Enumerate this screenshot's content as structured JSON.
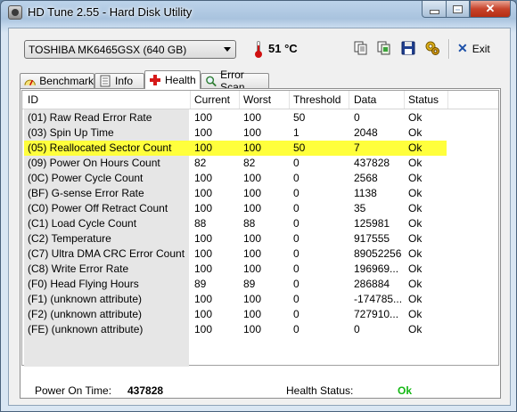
{
  "window": {
    "title": "HD Tune 2.55 - Hard Disk Utility"
  },
  "toolbar": {
    "drive": "TOSHIBA MK6465GSX (640 GB)",
    "temperature": "51 °C",
    "exit_label": "Exit"
  },
  "tabs": [
    {
      "label": "Benchmark"
    },
    {
      "label": "Info"
    },
    {
      "label": "Health"
    },
    {
      "label": "Error Scan"
    }
  ],
  "active_tab": "Health",
  "columns": [
    "ID",
    "Current",
    "Worst",
    "Threshold",
    "Data",
    "Status"
  ],
  "rows": [
    {
      "id": "(01) Raw Read Error Rate",
      "current": "100",
      "worst": "100",
      "threshold": "50",
      "data": "0",
      "status": "Ok"
    },
    {
      "id": "(03) Spin Up Time",
      "current": "100",
      "worst": "100",
      "threshold": "1",
      "data": "2048",
      "status": "Ok"
    },
    {
      "id": "(05) Reallocated Sector Count",
      "current": "100",
      "worst": "100",
      "threshold": "50",
      "data": "7",
      "status": "Ok",
      "highlight": true
    },
    {
      "id": "(09) Power On Hours Count",
      "current": "82",
      "worst": "82",
      "threshold": "0",
      "data": "437828",
      "status": "Ok"
    },
    {
      "id": "(0C) Power Cycle Count",
      "current": "100",
      "worst": "100",
      "threshold": "0",
      "data": "2568",
      "status": "Ok"
    },
    {
      "id": "(BF) G-sense Error Rate",
      "current": "100",
      "worst": "100",
      "threshold": "0",
      "data": "1138",
      "status": "Ok"
    },
    {
      "id": "(C0) Power Off Retract Count",
      "current": "100",
      "worst": "100",
      "threshold": "0",
      "data": "35",
      "status": "Ok"
    },
    {
      "id": "(C1) Load Cycle Count",
      "current": "88",
      "worst": "88",
      "threshold": "0",
      "data": "125981",
      "status": "Ok"
    },
    {
      "id": "(C2) Temperature",
      "current": "100",
      "worst": "100",
      "threshold": "0",
      "data": "917555",
      "status": "Ok"
    },
    {
      "id": "(C7) Ultra DMA CRC Error Count",
      "current": "100",
      "worst": "100",
      "threshold": "0",
      "data": "89052256",
      "status": "Ok"
    },
    {
      "id": "(C8) Write Error Rate",
      "current": "100",
      "worst": "100",
      "threshold": "0",
      "data": "196969...",
      "status": "Ok"
    },
    {
      "id": "(F0) Head Flying Hours",
      "current": "89",
      "worst": "89",
      "threshold": "0",
      "data": "286884",
      "status": "Ok"
    },
    {
      "id": "(F1) (unknown attribute)",
      "current": "100",
      "worst": "100",
      "threshold": "0",
      "data": "-174785...",
      "status": "Ok"
    },
    {
      "id": "(F2) (unknown attribute)",
      "current": "100",
      "worst": "100",
      "threshold": "0",
      "data": "727910...",
      "status": "Ok"
    },
    {
      "id": "(FE) (unknown attribute)",
      "current": "100",
      "worst": "100",
      "threshold": "0",
      "data": "0",
      "status": "Ok"
    }
  ],
  "footer": {
    "power_on_label": "Power On Time:",
    "power_on_value": "437828",
    "health_label": "Health Status:",
    "health_value": "Ok"
  },
  "colors": {
    "highlight": "#ffff3c",
    "ok_green": "#14b814",
    "exit_x": "#1b4fa8"
  }
}
